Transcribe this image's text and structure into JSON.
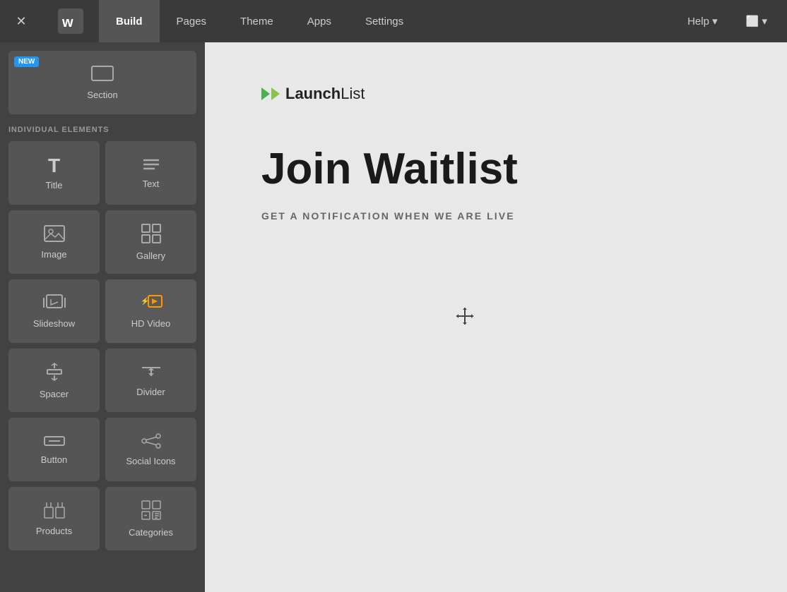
{
  "nav": {
    "close_icon": "✕",
    "tabs": [
      {
        "id": "build",
        "label": "Build",
        "active": true
      },
      {
        "id": "pages",
        "label": "Pages",
        "active": false
      },
      {
        "id": "theme",
        "label": "Theme",
        "active": false
      },
      {
        "id": "apps",
        "label": "Apps",
        "active": false
      },
      {
        "id": "settings",
        "label": "Settings",
        "active": false
      }
    ],
    "help_label": "Help ▾",
    "device_label": "⬜ ▾"
  },
  "sidebar": {
    "new_badge": "NEW",
    "section_label": "Section",
    "elements_heading": "INDIVIDUAL ELEMENTS",
    "elements": [
      {
        "id": "title",
        "label": "Title",
        "icon": "T"
      },
      {
        "id": "text",
        "label": "Text",
        "icon": "≡"
      },
      {
        "id": "image",
        "label": "Image",
        "icon": "🖼"
      },
      {
        "id": "gallery",
        "label": "Gallery",
        "icon": "⊞"
      },
      {
        "id": "slideshow",
        "label": "Slideshow",
        "icon": "⊡"
      },
      {
        "id": "hd-video",
        "label": "HD Video",
        "icon": "▶",
        "accent": true
      },
      {
        "id": "spacer",
        "label": "Spacer",
        "icon": "↕"
      },
      {
        "id": "divider",
        "label": "Divider",
        "icon": "÷"
      },
      {
        "id": "button",
        "label": "Button",
        "icon": "▬"
      },
      {
        "id": "social-icons",
        "label": "Social Icons",
        "icon": "⋯"
      },
      {
        "id": "products",
        "label": "Products",
        "icon": "⊡"
      },
      {
        "id": "categories",
        "label": "Categories",
        "icon": "⊞"
      }
    ]
  },
  "canvas": {
    "logo": {
      "text_bold": "Launch",
      "text_light": "List"
    },
    "hero_title": "Join Waitlist",
    "hero_subtitle": "GET A NOTIFICATION WHEN WE ARE LIVE"
  }
}
